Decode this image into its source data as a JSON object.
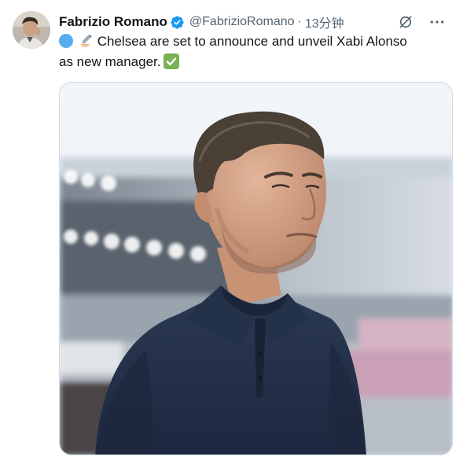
{
  "tweet": {
    "author_name": "Fabrizio Romano",
    "handle": "@FabrizioRomano",
    "separator": "·",
    "time": "13分钟",
    "text_line1": "Chelsea are set to announce and unveil Xabi Alonso",
    "text_line2": "as new manager.",
    "emojis": [
      "blue-circle",
      "writing-hand",
      "check-mark-button"
    ]
  },
  "icons": {
    "verified": "verified-badge-icon",
    "grok": "grok-icon",
    "more": "more-icon"
  },
  "colors": {
    "name": "#0f1419",
    "secondary": "#536471",
    "verified": "#1d9bf0",
    "border": "#cfd9de",
    "check_green": "#77b255",
    "blue_circle": "#55acee"
  }
}
